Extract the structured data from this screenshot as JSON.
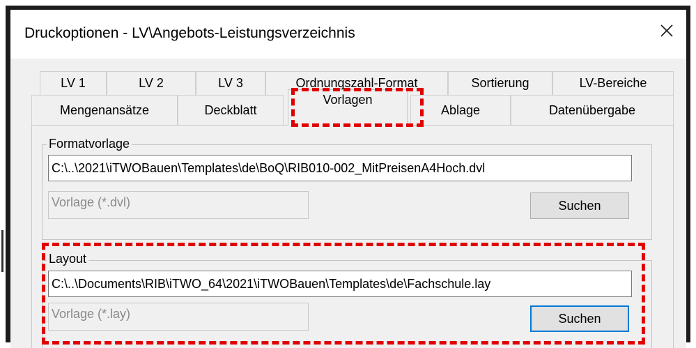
{
  "window": {
    "title": "Druckoptionen - LV\\Angebots-Leistungsverzeichnis",
    "close_label": "✕"
  },
  "tabs": {
    "row1": [
      "LV 1",
      "LV 2",
      "LV 3",
      "Ordnungszahl-Format",
      "Sortierung",
      "LV-Bereiche"
    ],
    "row2": [
      "Mengenansätze",
      "Deckblatt",
      "Vorlagen",
      "Ablage",
      "Datenübergabe"
    ],
    "active": "Vorlagen"
  },
  "formatvorlage": {
    "label": "Formatvorlage",
    "path": "C:\\..\\2021\\iTWOBauen\\Templates\\de\\BoQ\\RIB010-002_MitPreisenA4Hoch.dvl",
    "filter": "Vorlage (*.dvl)",
    "button": "Suchen"
  },
  "layout": {
    "label": "Layout",
    "path": "C:\\..\\Documents\\RIB\\iTWO_64\\2021\\iTWOBauen\\Templates\\de\\Fachschule.lay",
    "filter": "Vorlage (*.lay)",
    "button": "Suchen"
  },
  "colors": {
    "highlight": "#e00000",
    "focus": "#0078d7"
  }
}
